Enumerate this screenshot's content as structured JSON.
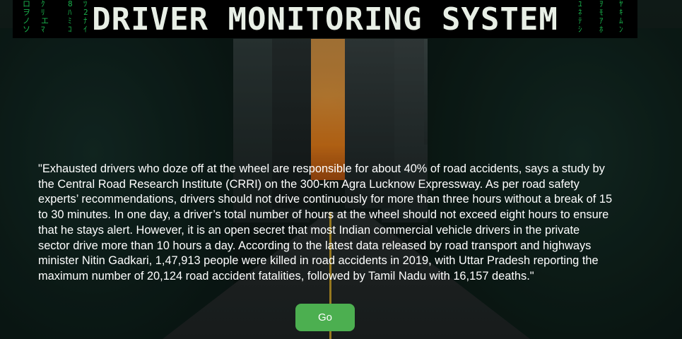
{
  "header": {
    "title": "DRIVER MONITORING SYSTEM"
  },
  "main": {
    "quote": "\"Exhausted drivers who doze off at the wheel are responsible for about 40% of road accidents, says a study by the Central Road Research Institute (CRRI) on the 300-km Agra Lucknow Expressway. As per road safety experts’ recommendations, drivers should not drive continuously for more than three hours without a break of 15 to 30 minutes. In one day, a driver’s total number of hours at the wheel should not exceed eight hours to ensure that he stays alert. However, it is an open secret that most Indian commercial vehicle drivers in the private sector drive more than 10 hours a day. According to the latest data released by road transport and highways minister Nitin Gadkari, 1,47,913 people were killed in road accidents in 2019, with Uttar Pradesh reporting the maximum number of 20,124 road accident fatalities, followed by Tamil Nadu with 16,157 deaths.\"",
    "go_label": "Go"
  },
  "colors": {
    "button_bg": "#4caf50",
    "title_banner_bg": "#000000",
    "matrix_green": "#1fd15a"
  }
}
